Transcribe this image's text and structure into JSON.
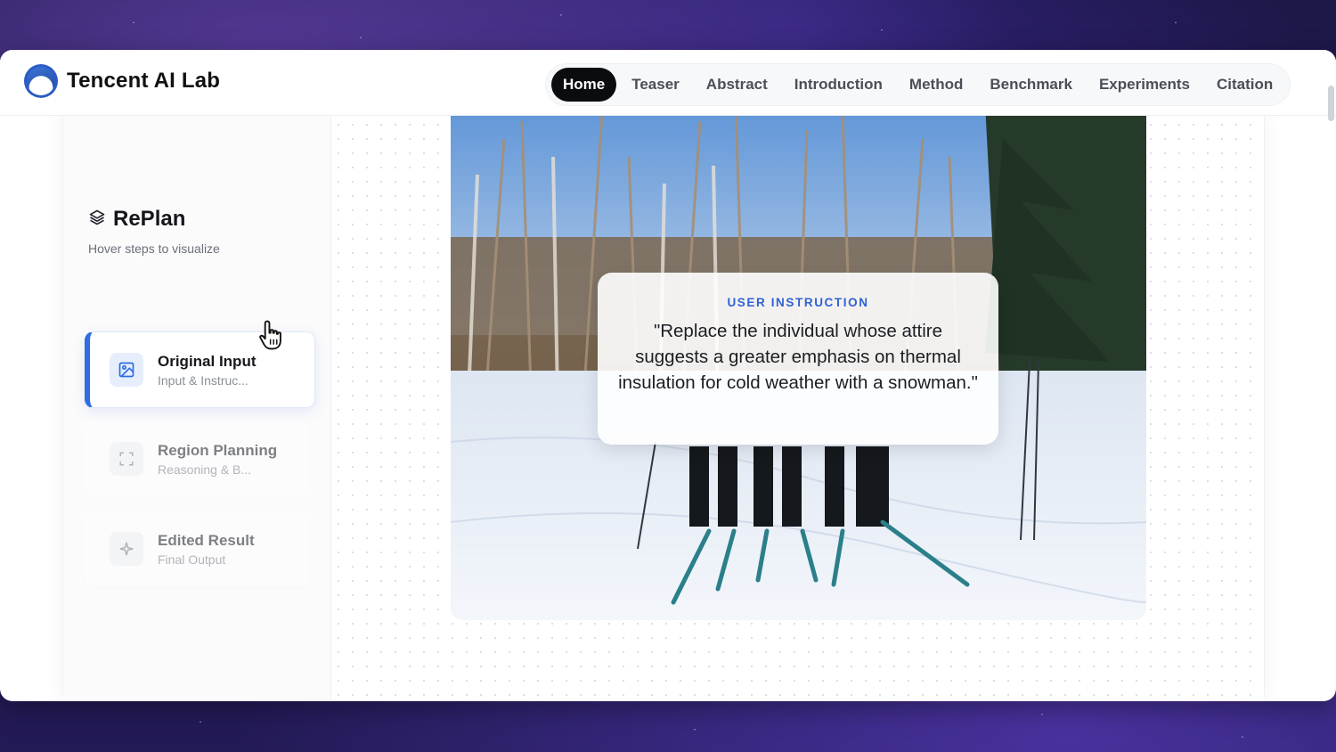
{
  "brand": {
    "name": "Tencent AI Lab",
    "logo_icon": "tencent-ai-lab-logo"
  },
  "nav": {
    "items": [
      {
        "label": "Home",
        "active": true
      },
      {
        "label": "Teaser",
        "active": false
      },
      {
        "label": "Abstract",
        "active": false
      },
      {
        "label": "Introduction",
        "active": false
      },
      {
        "label": "Method",
        "active": false
      },
      {
        "label": "Benchmark",
        "active": false
      },
      {
        "label": "Experiments",
        "active": false
      },
      {
        "label": "Citation",
        "active": false
      }
    ]
  },
  "sidebar": {
    "title": "RePlan",
    "title_icon": "layers-icon",
    "subtitle": "Hover steps to visualize",
    "steps": [
      {
        "title": "Original Input",
        "desc": "Input & Instruc...",
        "icon": "image-icon",
        "active": true
      },
      {
        "title": "Region Planning",
        "desc": "Reasoning & B...",
        "icon": "scan-frame-icon",
        "active": false
      },
      {
        "title": "Edited Result",
        "desc": "Final Output",
        "icon": "sparkle-icon",
        "active": false
      }
    ]
  },
  "viewer": {
    "image_alt": "",
    "instruction_label": "USER INSTRUCTION",
    "instruction_text": "\"Replace the individual whose attire suggests a greater emphasis on thermal insulation for cold weather with a snowman.\""
  },
  "colors": {
    "accent": "#2f6de1",
    "nav_active_bg": "#0b0c0f",
    "label_blue": "#2e62d6"
  }
}
